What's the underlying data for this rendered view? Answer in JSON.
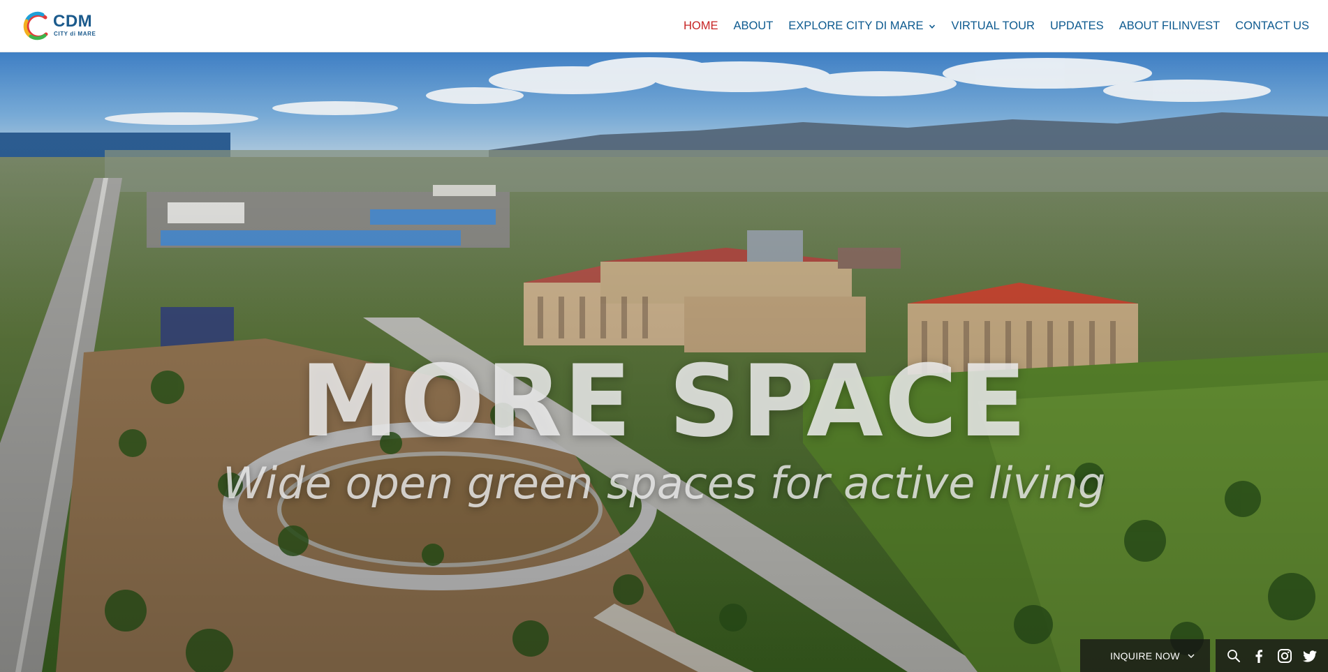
{
  "header": {
    "logo": {
      "text": "CDM",
      "subtext": "CITY di MARE"
    },
    "nav": [
      {
        "label": "HOME",
        "active": true
      },
      {
        "label": "ABOUT",
        "active": false
      },
      {
        "label": "EXPLORE CITY DI MARE",
        "active": false,
        "has_dropdown": true
      },
      {
        "label": "VIRTUAL TOUR",
        "active": false
      },
      {
        "label": "UPDATES",
        "active": false
      },
      {
        "label": "ABOUT FILINVEST",
        "active": false
      },
      {
        "label": "CONTACT US",
        "active": false
      }
    ]
  },
  "hero": {
    "headline": "MORE SPACE",
    "subline": "Wide open green spaces for active living"
  },
  "inquire": {
    "label": "INQUIRE NOW"
  },
  "social": {
    "icons": [
      "search-icon",
      "facebook-icon",
      "instagram-icon",
      "twitter-icon"
    ]
  },
  "colors": {
    "nav_text": "#0d5a8f",
    "nav_active": "#c72323",
    "bar_bg": "#141414"
  }
}
